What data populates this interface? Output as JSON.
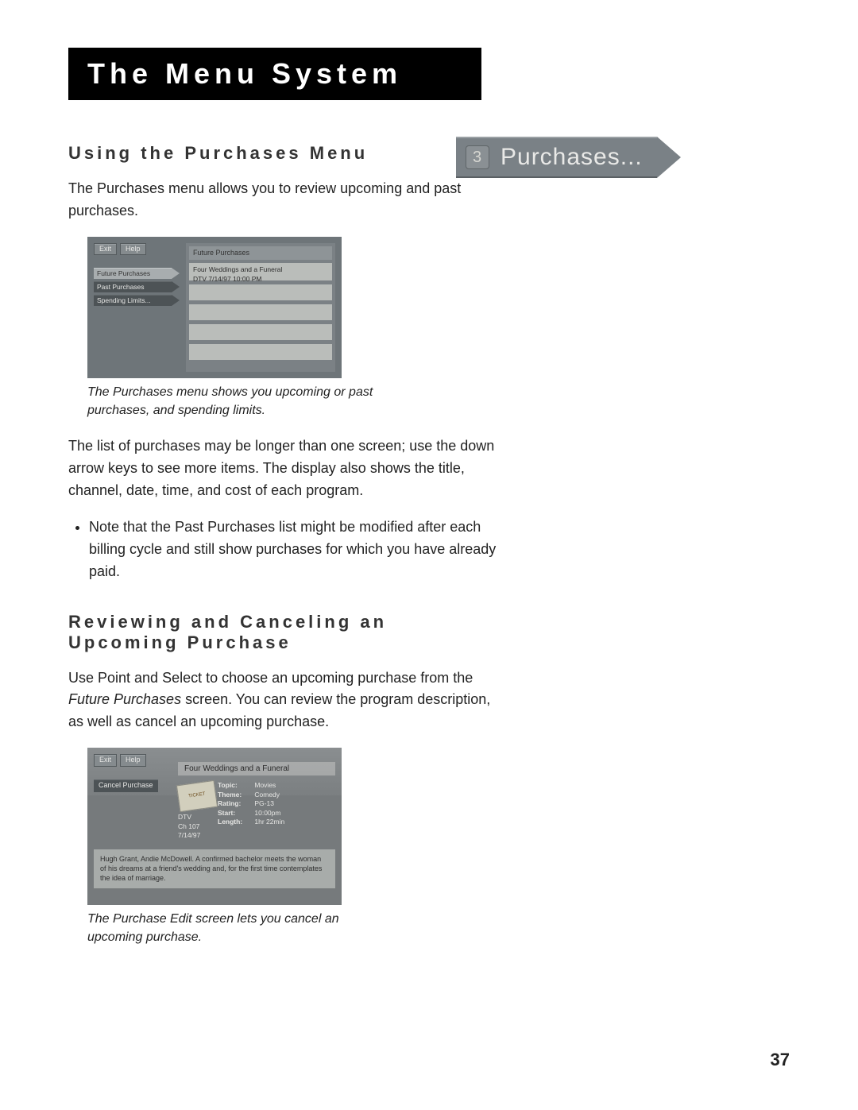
{
  "header": {
    "title": "The Menu System"
  },
  "arrow_button": {
    "number": "3",
    "label": "Purchases..."
  },
  "section1": {
    "heading": "Using the Purchases Menu",
    "intro": "The Purchases menu allows you to review upcoming and past purchases.",
    "shot": {
      "exit": "Exit",
      "help": "Help",
      "nav": {
        "future": "Future Purchases",
        "past": "Past Purchases",
        "spending": "Spending Limits..."
      },
      "list_header": "Future Purchases",
      "row1_line1": "Four Weddings and a Funeral",
      "row1_line2": "DTV   7/14/97   10:00 PM"
    },
    "caption": "The Purchases menu shows you upcoming or past purchases, and spending limits.",
    "para2": "The list of purchases may be longer than one screen; use the down arrow keys to see more items. The display also shows the title, channel, date, time, and cost of each program.",
    "bullet1": "Note that the Past Purchases list might be modified after each billing cycle and still show purchases for which you have already paid."
  },
  "section2": {
    "heading": "Reviewing and Canceling an Upcoming Purchase",
    "para1a": "Use Point and Select to choose an upcoming purchase from the ",
    "para1_em": "Future Purchases",
    "para1b": " screen. You can review the program description, as well as cancel an upcoming purchase.",
    "shot": {
      "exit": "Exit",
      "help": "Help",
      "cancel": "Cancel Purchase",
      "title": "Four Weddings and a Funeral",
      "ticket": "TICKET",
      "kv": {
        "topic_k": "Topic:",
        "topic_v": "Movies",
        "theme_k": "Theme:",
        "theme_v": "Comedy",
        "rating_k": "Rating:",
        "rating_v": "PG-13",
        "start_k": "Start:",
        "start_v": "10:00pm",
        "length_k": "Length:",
        "length_v": "1hr 22min"
      },
      "ch_line1": "DTV",
      "ch_line2": "Ch 107",
      "ch_line3": "7/14/97",
      "desc": "Hugh Grant, Andie McDowell. A confirmed bachelor meets the woman of his dreams at a friend's wedding and, for the first time contemplates the idea of marriage."
    },
    "caption": "The Purchase Edit screen lets you cancel an upcoming purchase."
  },
  "page_number": "37"
}
